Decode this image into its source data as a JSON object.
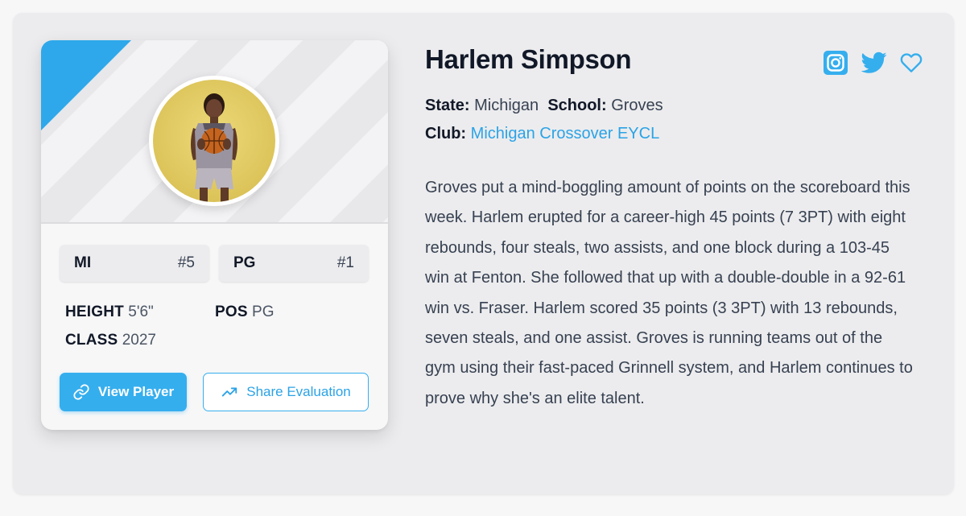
{
  "player": {
    "name": "Harlem Simpson",
    "state_label": "State:",
    "state": "Michigan",
    "school_label": "School:",
    "school": "Groves",
    "club_label": "Club:",
    "club": "Michigan Crossover EYCL"
  },
  "card": {
    "rank_state": {
      "label": "MI",
      "value": "#5"
    },
    "rank_pos": {
      "label": "PG",
      "value": "#1"
    },
    "height_label": "HEIGHT",
    "height": "5'6\"",
    "class_label": "CLASS",
    "class": "2027",
    "pos_label": "POS",
    "pos": "PG",
    "view_button": "View Player",
    "share_button": "Share Evaluation"
  },
  "description": "Groves put a mind-boggling amount of points on the scoreboard this week. Harlem erupted for a career-high 45 points (7 3PT) with eight rebounds, four steals, two assists, and one block during a 103-45 win at Fenton. She followed that up with a double-double in a 92-61 win vs. Fraser. Harlem scored 35 points (3 3PT) with 13 rebounds, seven steals, and one assist. Groves is running teams out of the gym using their fast-paced Grinnell system, and Harlem continues to prove why she's an elite talent.",
  "icons": [
    "instagram-icon",
    "twitter-icon",
    "heart-icon",
    "link-icon",
    "trending-up-icon"
  ],
  "colors": {
    "accent": "#35aeee",
    "link": "#2ba3e6"
  }
}
